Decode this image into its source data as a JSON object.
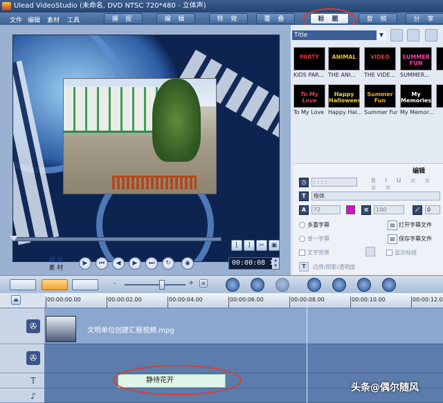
{
  "window": {
    "title": "Ulead VideoStudio (未命名, DVD NTSC 720*480 - 立体声)"
  },
  "menu": {
    "items": [
      "文件",
      "编辑",
      "素材",
      "工具"
    ]
  },
  "steps": [
    "捕 捉",
    "编 辑",
    "特 效",
    "覆 叠",
    "标 题",
    "音 频",
    "分 享"
  ],
  "active_step": "标 题",
  "preview": {
    "timecode": "00:00:08 18"
  },
  "project_toggle": {
    "project": "项 目",
    "clip": "素 材"
  },
  "library": {
    "category": "Title",
    "thumbnails": [
      {
        "label": "KIDS PAR...",
        "art": "PARTY"
      },
      {
        "label": "THE ANI...",
        "art": "ANIMAL"
      },
      {
        "label": "THE VIDE...",
        "art": "VIDEO"
      },
      {
        "label": "SUMMER...",
        "art": "SUMMER FUN"
      },
      {
        "label": "To My Love",
        "art": "To My Love"
      },
      {
        "label": "Happy Hal...",
        "art": "Happy Halloween"
      },
      {
        "label": "Summer Fun",
        "art": "Summer Fun"
      },
      {
        "label": "My Memor...",
        "art": "My Memories"
      }
    ]
  },
  "options": {
    "tab_label": "编辑",
    "font_name": "楷体",
    "font_size": "72",
    "line_spacing": "100",
    "rotation": "0",
    "text_color": "#d40fc8",
    "multi_title": "多重字幕",
    "single_title": "单一字幕",
    "open_subtitle": "打开字幕文件",
    "save_subtitle": "保存字幕文件",
    "text_background": "文字背景",
    "show_safe_area": "显示标线",
    "border_shadow": "边界/阴影/透明度"
  },
  "timeline": {
    "ruler": [
      "00:00:00.00",
      "00:00:02.00",
      "00:00:04.00",
      "00:00:06.00",
      "00:00:08.00",
      "00:00:10.00",
      "00:00:12.00"
    ],
    "video_clip": "文明单位创建汇报视频.mpg",
    "title_clip": "静待花开",
    "zoom_in": "+",
    "zoom_out": "-"
  },
  "watermark": "头条@偶尔随风",
  "colors": {
    "accent": "#3c5f97",
    "highlight": "#e23a2a",
    "title_color": "#d40fc8"
  }
}
